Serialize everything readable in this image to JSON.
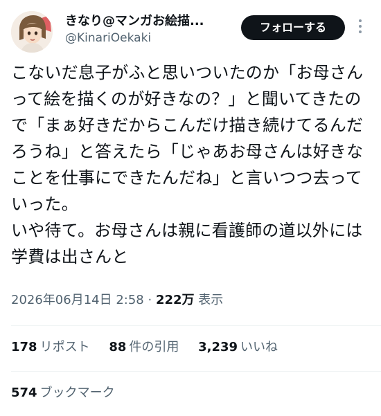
{
  "author": {
    "display_name": "きなり@マンガお絵描...",
    "handle": "@KinariOekaki",
    "avatar_icon": "manga-avatar-icon"
  },
  "follow_button": {
    "label": "フォローする"
  },
  "more_icon": "more-dots-icon",
  "tweet": {
    "text": "こないだ息子がふと思いついたのか「お母さんって絵を描くのが好きなの？」と聞いてきたので「まぁ好きだからこんだけ描き続けてるんだろうね」と答えたら「じゃあお母さんは好きなことを仕事にできたんだね」と言いつつ去っていった。\nいや待て。お母さんは親に看護師の道以外には学費は出さんと"
  },
  "meta": {
    "date": "2026年06月14日 2:58",
    "separator": "·",
    "views_count": "222万",
    "views_label": "表示"
  },
  "stats": {
    "reposts_count": "178",
    "reposts_label": "リポスト",
    "quotes_count": "88",
    "quotes_label": "件の引用",
    "likes_count": "3,239",
    "likes_label": "いいね"
  },
  "bookmarks": {
    "count": "574",
    "label": "ブックマーク"
  },
  "colors": {
    "text": "#0f1419",
    "secondary": "#536471",
    "button_bg": "#0f1419",
    "divider": "#eff3f4"
  }
}
